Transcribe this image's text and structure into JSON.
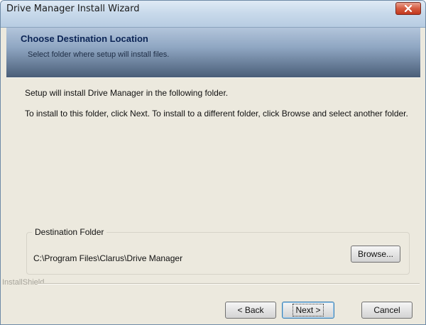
{
  "window": {
    "title": "Drive Manager Install Wizard"
  },
  "banner": {
    "title": "Choose Destination Location",
    "subtitle": "Select folder where setup will install files."
  },
  "body": {
    "line1": "Setup will install Drive Manager in the following folder.",
    "line2": "To install to this folder, click Next. To install to a different folder, click Browse and select another folder."
  },
  "destination": {
    "group_label": "Destination Folder",
    "path": "C:\\Program Files\\Clarus\\Drive Manager",
    "browse_label": "Browse..."
  },
  "footer": {
    "brand": "InstallShield",
    "back_label": "< Back",
    "next_label": "Next >",
    "cancel_label": "Cancel"
  },
  "icons": {
    "close": "close-icon"
  }
}
